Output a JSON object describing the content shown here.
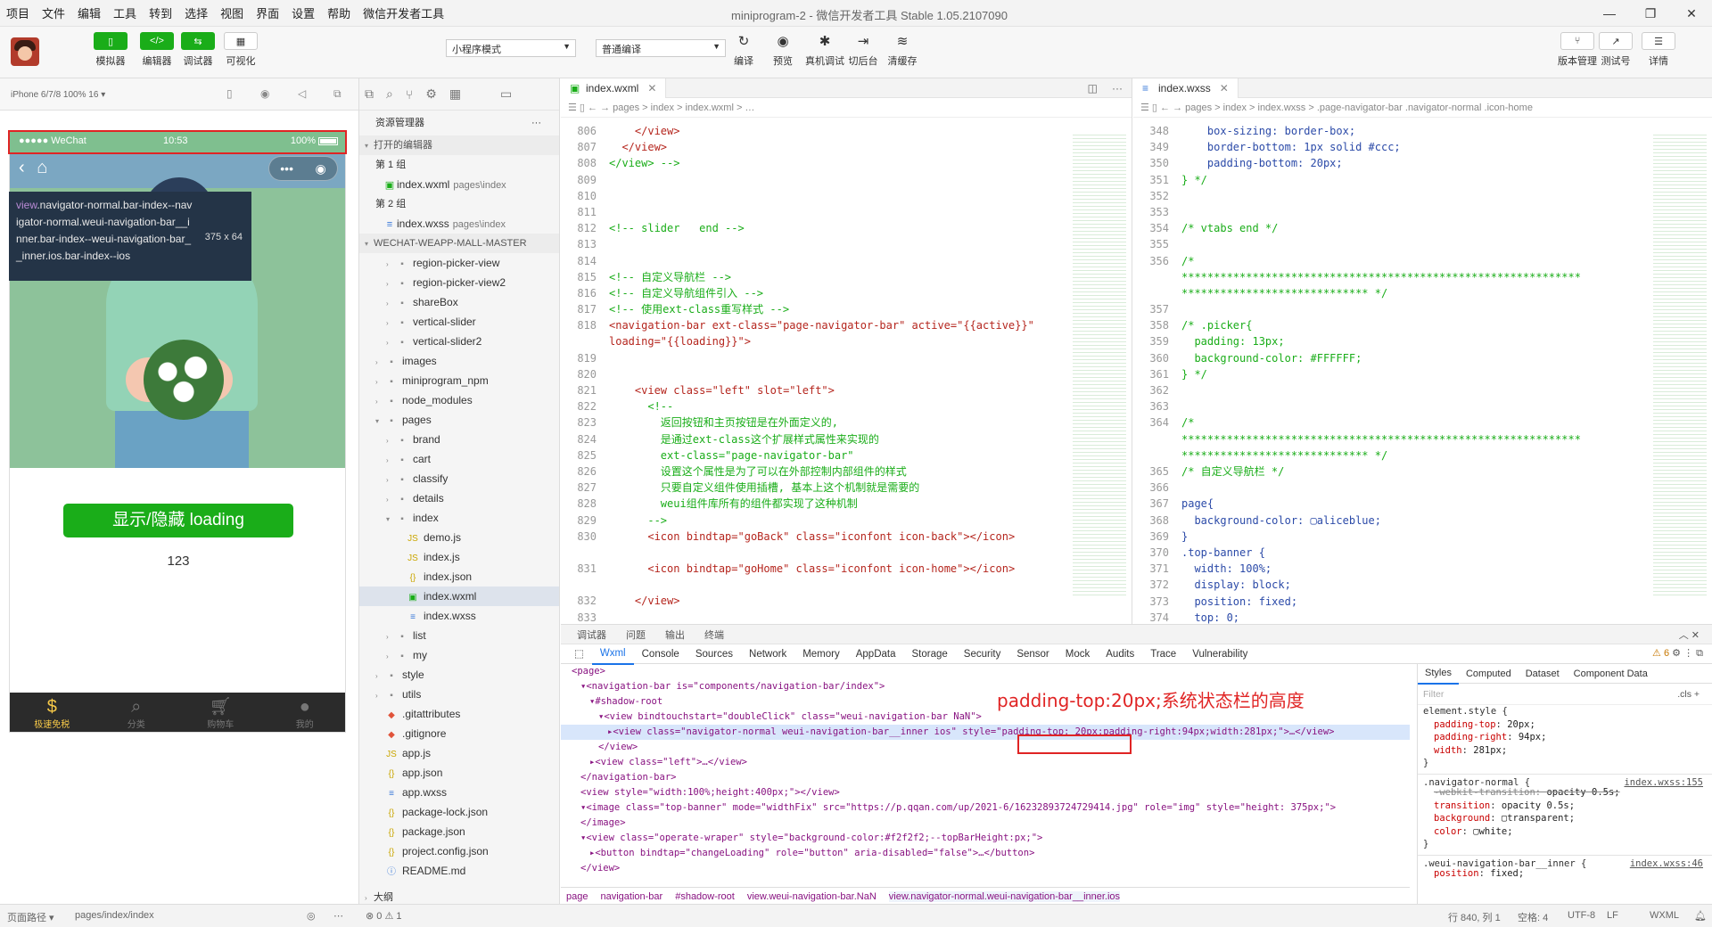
{
  "menu": [
    "项目",
    "文件",
    "编辑",
    "工具",
    "转到",
    "选择",
    "视图",
    "界面",
    "设置",
    "帮助",
    "微信开发者工具"
  ],
  "window_title": "miniprogram-2 - 微信开发者工具 Stable 1.05.2107090",
  "toolbar": {
    "left_buttons": [
      {
        "label": "模拟器",
        "icon": "phone-icon"
      },
      {
        "label": "编辑器",
        "icon": "code-icon"
      },
      {
        "label": "调试器",
        "icon": "debug-icon"
      },
      {
        "label": "可视化",
        "icon": "layout-icon"
      }
    ],
    "mode_select": "小程序模式",
    "compile_select": "普通编译",
    "mid_buttons": [
      "编译",
      "预览",
      "真机调试",
      "切后台",
      "清缓存"
    ],
    "right_buttons": [
      "版本管理",
      "测试号",
      "详情"
    ]
  },
  "simulator": {
    "device": "iPhone 6/7/8 100% 16 ▾",
    "status_left": "●●●●● WeChat",
    "status_time": "10:53",
    "status_battery": "100%",
    "tooltip_selector_tag": "view",
    "tooltip_selector": ".navigator-normal.bar-index--navigator-normal.weui-navigation-bar__inner.bar-index--weui-navigation-bar__inner.ios.bar-index--ios",
    "tooltip_size": "375 x 64",
    "button_label": "显示/隐藏 loading",
    "number": "123",
    "tabs": [
      {
        "label": "极速免税",
        "icon": "money-bag-icon",
        "active": true
      },
      {
        "label": "分类",
        "icon": "search-list-icon",
        "active": false
      },
      {
        "label": "购物车",
        "icon": "cart-icon",
        "active": false
      },
      {
        "label": "我的",
        "icon": "user-icon",
        "active": false
      }
    ]
  },
  "bottom_left": {
    "path_label": "页面路径 ▾",
    "path": "pages/index/index"
  },
  "explorer": {
    "title": "资源管理器",
    "open_editors": "打开的编辑器",
    "group1": "第 1 组",
    "group1_file": "index.wxml",
    "group1_sub": "pages\\index",
    "group2": "第 2 组",
    "group2_file": "index.wxss",
    "group2_sub": "pages\\index",
    "project": "WECHAT-WEAPP-MALL-MASTER",
    "tree": [
      {
        "name": "region-picker-view",
        "type": "folder",
        "depth": 2
      },
      {
        "name": "region-picker-view2",
        "type": "folder",
        "depth": 2
      },
      {
        "name": "shareBox",
        "type": "folder",
        "depth": 2
      },
      {
        "name": "vertical-slider",
        "type": "folder",
        "depth": 2
      },
      {
        "name": "vertical-slider2",
        "type": "folder",
        "depth": 2
      },
      {
        "name": "images",
        "type": "folder",
        "depth": 1
      },
      {
        "name": "miniprogram_npm",
        "type": "folder",
        "depth": 1
      },
      {
        "name": "node_modules",
        "type": "folder",
        "depth": 1
      },
      {
        "name": "pages",
        "type": "folder-open",
        "depth": 1
      },
      {
        "name": "brand",
        "type": "folder",
        "depth": 2
      },
      {
        "name": "cart",
        "type": "folder",
        "depth": 2
      },
      {
        "name": "classify",
        "type": "folder",
        "depth": 2
      },
      {
        "name": "details",
        "type": "folder",
        "depth": 2
      },
      {
        "name": "index",
        "type": "folder-open",
        "depth": 2
      },
      {
        "name": "demo.js",
        "type": "js",
        "depth": 3
      },
      {
        "name": "index.js",
        "type": "js",
        "depth": 3
      },
      {
        "name": "index.json",
        "type": "json",
        "depth": 3
      },
      {
        "name": "index.wxml",
        "type": "wxml",
        "depth": 3,
        "selected": true
      },
      {
        "name": "index.wxss",
        "type": "wxss",
        "depth": 3
      },
      {
        "name": "list",
        "type": "folder",
        "depth": 2
      },
      {
        "name": "my",
        "type": "folder",
        "depth": 2
      },
      {
        "name": "style",
        "type": "folder",
        "depth": 1
      },
      {
        "name": "utils",
        "type": "folder",
        "depth": 1
      },
      {
        "name": ".gitattributes",
        "type": "git",
        "depth": 1
      },
      {
        "name": ".gitignore",
        "type": "git",
        "depth": 1
      },
      {
        "name": "app.js",
        "type": "js",
        "depth": 1
      },
      {
        "name": "app.json",
        "type": "json",
        "depth": 1
      },
      {
        "name": "app.wxss",
        "type": "wxss",
        "depth": 1
      },
      {
        "name": "package-lock.json",
        "type": "json",
        "depth": 1
      },
      {
        "name": "package.json",
        "type": "json",
        "depth": 1
      },
      {
        "name": "project.config.json",
        "type": "json",
        "depth": 1
      },
      {
        "name": "README.md",
        "type": "md",
        "depth": 1
      }
    ],
    "outline": "大纲",
    "problems": "⊗ 0 ⚠ 1"
  },
  "editor1": {
    "tab": "index.wxml",
    "crumb": "pages > index > index.wxml > …",
    "lines": [
      {
        "n": "806",
        "t": "    </view>",
        "c": "tag"
      },
      {
        "n": "807",
        "t": "  </view>",
        "c": "tag"
      },
      {
        "n": "808",
        "t": "</view> -->",
        "c": "com"
      },
      {
        "n": "809",
        "t": "",
        "c": ""
      },
      {
        "n": "810",
        "t": "",
        "c": ""
      },
      {
        "n": "811",
        "t": "",
        "c": ""
      },
      {
        "n": "812",
        "t": "<!-- slider   end -->",
        "c": "com"
      },
      {
        "n": "813",
        "t": "",
        "c": ""
      },
      {
        "n": "814",
        "t": "",
        "c": ""
      },
      {
        "n": "815",
        "t": "<!-- 自定义导航栏 -->",
        "c": "com"
      },
      {
        "n": "816",
        "t": "<!-- 自定义导航组件引入 -->",
        "c": "com"
      },
      {
        "n": "817",
        "t": "<!-- 使用ext-class重写样式 -->",
        "c": "com"
      },
      {
        "n": "818",
        "t": "<navigation-bar ext-class=\"page-navigator-bar\" active=\"{{active}}\" loading=\"{{loading}}\">",
        "c": "tag",
        "tall": true
      },
      {
        "n": "819",
        "t": "",
        "c": ""
      },
      {
        "n": "820",
        "t": "",
        "c": ""
      },
      {
        "n": "821",
        "t": "    <view class=\"left\" slot=\"left\">",
        "c": "tag"
      },
      {
        "n": "822",
        "t": "      <!--",
        "c": "com"
      },
      {
        "n": "823",
        "t": "        返回按钮和主页按钮是在外面定义的,",
        "c": "com"
      },
      {
        "n": "824",
        "t": "        是通过ext-class这个扩展样式属性来实现的",
        "c": "com"
      },
      {
        "n": "825",
        "t": "        ext-class=\"page-navigator-bar\"",
        "c": "com"
      },
      {
        "n": "826",
        "t": "        设置这个属性是为了可以在外部控制内部组件的样式",
        "c": "com"
      },
      {
        "n": "827",
        "t": "        只要自定义组件使用插槽, 基本上这个机制就是需要的",
        "c": "com"
      },
      {
        "n": "828",
        "t": "        weui组件库所有的组件都实现了这种机制",
        "c": "com"
      },
      {
        "n": "829",
        "t": "      -->",
        "c": "com"
      },
      {
        "n": "830",
        "t": "      <icon bindtap=\"goBack\" class=\"iconfont icon-back\"></icon>",
        "c": "tag",
        "tall": true
      },
      {
        "n": "831",
        "t": "      <icon bindtap=\"goHome\" class=\"iconfont icon-home\"></icon>",
        "c": "tag",
        "tall": true
      },
      {
        "n": "832",
        "t": "    </view>",
        "c": "tag"
      },
      {
        "n": "833",
        "t": "",
        "c": ""
      }
    ]
  },
  "editor2": {
    "tab": "index.wxss",
    "crumb": "pages > index > index.wxss > .page-navigator-bar .navigator-normal .icon-home",
    "lines": [
      {
        "n": "348",
        "t": "    box-sizing: border-box;",
        "c": "css"
      },
      {
        "n": "349",
        "t": "    border-bottom: 1px solid #ccc;",
        "c": "css"
      },
      {
        "n": "350",
        "t": "    padding-bottom: 20px;",
        "c": "css"
      },
      {
        "n": "351",
        "t": "} */",
        "c": "com"
      },
      {
        "n": "352",
        "t": "",
        "c": ""
      },
      {
        "n": "353",
        "t": "",
        "c": ""
      },
      {
        "n": "354",
        "t": "/* vtabs end */",
        "c": "com"
      },
      {
        "n": "355",
        "t": "",
        "c": ""
      },
      {
        "n": "356",
        "t": "/*\n**************************************************************\n***************************** */",
        "c": "com",
        "tall3": true
      },
      {
        "n": "357",
        "t": "",
        "c": ""
      },
      {
        "n": "358",
        "t": "/* .picker{",
        "c": "com"
      },
      {
        "n": "359",
        "t": "  padding: 13px;",
        "c": "com"
      },
      {
        "n": "360",
        "t": "  background-color: #FFFFFF;",
        "c": "com"
      },
      {
        "n": "361",
        "t": "} */",
        "c": "com"
      },
      {
        "n": "362",
        "t": "",
        "c": ""
      },
      {
        "n": "363",
        "t": "",
        "c": ""
      },
      {
        "n": "364",
        "t": "/*\n**************************************************************\n***************************** */",
        "c": "com",
        "tall3": true
      },
      {
        "n": "365",
        "t": "/* 自定义导航栏 */",
        "c": "com"
      },
      {
        "n": "366",
        "t": "",
        "c": ""
      },
      {
        "n": "367",
        "t": "page{",
        "c": "css"
      },
      {
        "n": "368",
        "t": "  background-color: ▢aliceblue;",
        "c": "css"
      },
      {
        "n": "369",
        "t": "}",
        "c": "css"
      },
      {
        "n": "370",
        "t": ".top-banner {",
        "c": "css"
      },
      {
        "n": "371",
        "t": "  width: 100%;",
        "c": "css"
      },
      {
        "n": "372",
        "t": "  display: block;",
        "c": "css"
      },
      {
        "n": "373",
        "t": "  position: fixed;",
        "c": "css"
      },
      {
        "n": "374",
        "t": "  top: 0;",
        "c": "css"
      }
    ]
  },
  "devtools": {
    "top_tabs": [
      "调试器",
      "问题",
      "输出",
      "终端"
    ],
    "problem_count": "1",
    "tabs": [
      "Wxml",
      "Console",
      "Sources",
      "Network",
      "Memory",
      "AppData",
      "Storage",
      "Security",
      "Sensor",
      "Mock",
      "Audits",
      "Trace",
      "Vulnerability"
    ],
    "warn_count": "⚠ 6",
    "annotation": "padding-top:20px;系统状态栏的高度",
    "dom": [
      {
        "indent": 0,
        "html": "<page>"
      },
      {
        "indent": 1,
        "html": "▾<navigation-bar is=\"components/navigation-bar/index\">"
      },
      {
        "indent": 2,
        "html": "▾#shadow-root"
      },
      {
        "indent": 3,
        "html": "▾<view bindtouchstart=\"doubleClick\" class=\"weui-navigation-bar NaN\">"
      },
      {
        "indent": 4,
        "html": "▸<view class=\"navigator-normal weui-navigation-bar__inner ios\" style=\"padding-top: 20px;padding-right:94px;width:281px;\">…</view>",
        "hl": true
      },
      {
        "indent": 3,
        "html": "</view>"
      },
      {
        "indent": 2,
        "html": "▸<view class=\"left\">…</view>"
      },
      {
        "indent": 1,
        "html": "</navigation-bar>"
      },
      {
        "indent": 1,
        "html": "<view style=\"width:100%;height:400px;\"></view>"
      },
      {
        "indent": 1,
        "html": "▾<image class=\"top-banner\" mode=\"widthFix\" src=\"https://p.qqan.com/up/2021-6/16232893724729414.jpg\" role=\"img\" style=\"height: 375px;\">"
      },
      {
        "indent": 1,
        "html": "</image>"
      },
      {
        "indent": 1,
        "html": "▾<view class=\"operate-wraper\" style=\"background-color:#f2f2f2;--topBarHeight:px;\">"
      },
      {
        "indent": 2,
        "html": "▸<button bindtap=\"changeLoading\" role=\"button\" aria-disabled=\"false\">…</button>"
      },
      {
        "indent": 1,
        "html": "</view>"
      }
    ],
    "crumbs": [
      "page",
      "navigation-bar",
      "#shadow-root",
      "view.weui-navigation-bar.NaN",
      "view.navigator-normal.weui-navigation-bar__inner.ios"
    ],
    "styles_tabs": [
      "Styles",
      "Computed",
      "Dataset",
      "Component Data"
    ],
    "filter_placeholder": "Filter",
    "filter_right": ".cls  +",
    "styles": [
      {
        "type": "head",
        "text": "element.style {"
      },
      {
        "type": "prop",
        "p": "padding-top",
        "v": "20px;"
      },
      {
        "type": "prop",
        "p": "padding-right",
        "v": "94px;"
      },
      {
        "type": "prop",
        "p": "width",
        "v": "281px;"
      },
      {
        "type": "end",
        "text": "}"
      },
      {
        "type": "head",
        "text": ".navigator-normal {",
        "src": "index.wxss:155",
        "div": true
      },
      {
        "type": "prop",
        "p": "-webkit-transition",
        "v": "opacity 0.5s;",
        "strike": true
      },
      {
        "type": "prop",
        "p": "transition",
        "v": "opacity 0.5s;"
      },
      {
        "type": "prop",
        "p": "background",
        "v": "▢transparent;"
      },
      {
        "type": "prop",
        "p": "color",
        "v": "▢white;"
      },
      {
        "type": "end",
        "text": "}"
      },
      {
        "type": "head",
        "text": ".weui-navigation-bar__inner {",
        "src": "index.wxss:46",
        "div": true
      },
      {
        "type": "prop",
        "p": "position",
        "v": "fixed;"
      }
    ]
  },
  "statusbar_right": {
    "pos": "行 840, 列 1",
    "spaces": "空格: 4",
    "enc": "UTF-8",
    "lf": "LF",
    "lang": "WXML"
  }
}
